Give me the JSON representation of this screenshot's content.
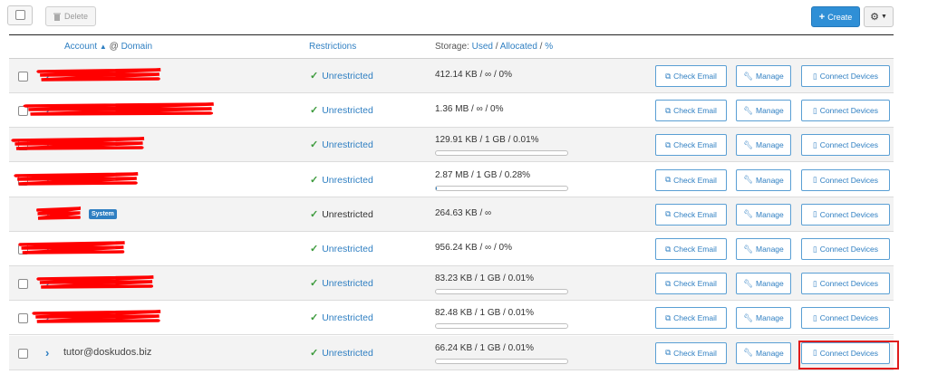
{
  "toolbar": {
    "delete_label": "Delete",
    "create_label": "Create"
  },
  "header": {
    "account": "Account",
    "at": "@",
    "domain": "Domain",
    "restrictions": "Restrictions",
    "storage_prefix": "Storage:",
    "used": "Used",
    "sep1": "/",
    "allocated": "Allocated",
    "sep2": "/",
    "percent": "%"
  },
  "rows": [
    {
      "account": "",
      "redacted": true,
      "badge": "",
      "restriction": "Unrestricted",
      "storage": "412.14 KB / ∞ / 0%",
      "progress": null
    },
    {
      "account": "",
      "redacted": true,
      "badge": "",
      "restriction": "Unrestricted",
      "storage": "1.36 MB / ∞ / 0%",
      "progress": null
    },
    {
      "account": "",
      "redacted": true,
      "badge": "",
      "restriction": "Unrestricted",
      "storage": "129.91 KB / 1 GB / 0.01%",
      "progress": 0.0001
    },
    {
      "account": "",
      "redacted": true,
      "badge": "",
      "restriction": "Unrestricted",
      "storage": "2.87 MB / 1 GB / 0.28%",
      "progress": 0.0028
    },
    {
      "account": "",
      "redacted": true,
      "badge": "System",
      "restriction": "Unrestricted",
      "storage": "264.63 KB / ∞",
      "progress": null
    },
    {
      "account": "",
      "redacted": true,
      "badge": "",
      "restriction": "Unrestricted",
      "storage": "956.24 KB / ∞ / 0%",
      "progress": null
    },
    {
      "account": "",
      "redacted": true,
      "badge": "",
      "restriction": "Unrestricted",
      "storage": "83.23 KB / 1 GB / 0.01%",
      "progress": 0.0001
    },
    {
      "account": "",
      "redacted": true,
      "badge": "",
      "restriction": "Unrestricted",
      "storage": "82.48 KB / 1 GB / 0.01%",
      "progress": 0.0001
    },
    {
      "account": "tutor@doskudos.biz",
      "redacted": false,
      "badge": "",
      "restriction": "Unrestricted",
      "storage": "66.24 KB / 1 GB / 0.01%",
      "progress": 0.0001
    }
  ],
  "actions": {
    "check_email": "Check Email",
    "manage": "Manage",
    "connect_devices": "Connect Devices"
  },
  "colors": {
    "accent": "#2f7fc2",
    "create_button": "#2f8fd6",
    "success_check": "#3c9a3c",
    "redaction": "#ff0000",
    "highlight_box": "#e01b1b"
  },
  "icons": [
    "checkbox-icon",
    "trash-icon",
    "plus-icon",
    "gear-icon",
    "caret-down-icon",
    "sort-up-icon",
    "chevron-right-icon",
    "check-icon",
    "external-link-icon",
    "wrench-icon",
    "mobile-icon"
  ]
}
